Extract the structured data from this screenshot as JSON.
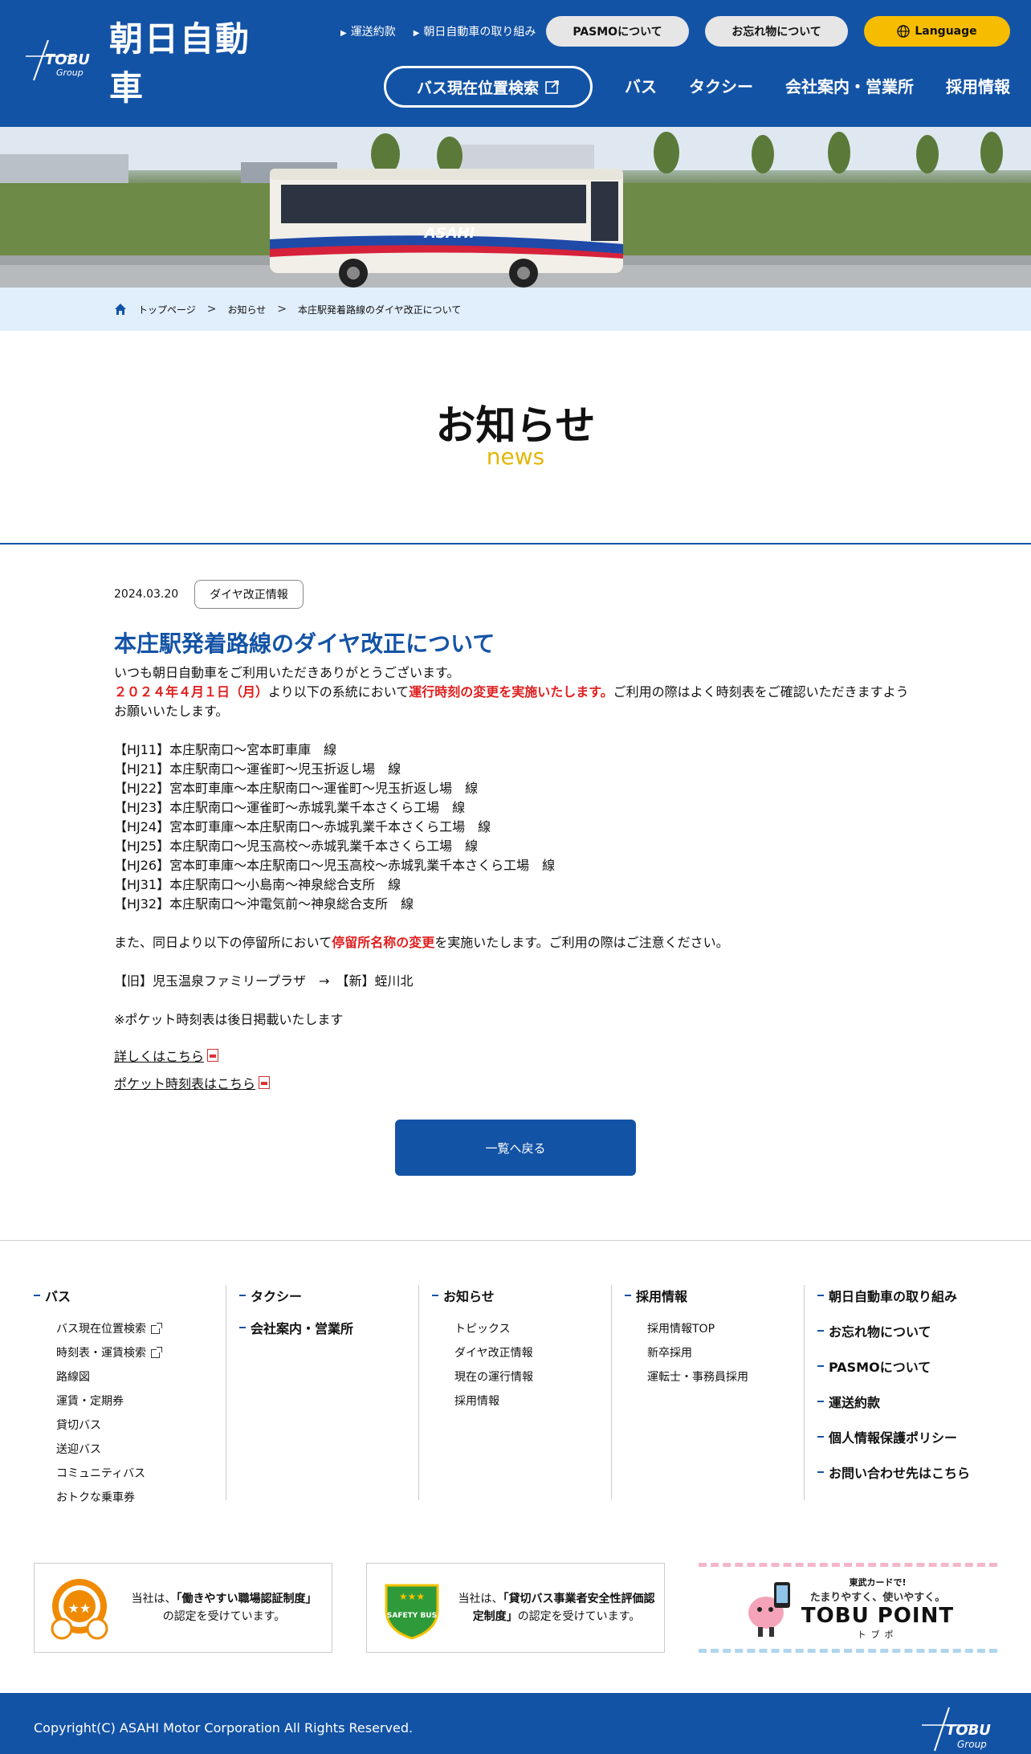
{
  "header": {
    "logo_text": "朝日自動車",
    "logo_mark_text": "TOBU",
    "logo_mark_sub": "Group",
    "toplinks": [
      "運送約款",
      "朝日自動車の取り組み"
    ],
    "pasmo_label": "PASMOについて",
    "lost_label": "お忘れ物について",
    "language_label": "Language",
    "bus_search_label": "バス現在位置検索",
    "nav": [
      "バス",
      "タクシー",
      "会社案内・営業所",
      "採用情報"
    ]
  },
  "hero": {
    "bus_label": "ASAHI"
  },
  "breadcrumb": {
    "home": "トップページ",
    "level2": "お知らせ",
    "current": "本庄駅発着路線のダイヤ改正について",
    "separator": ">"
  },
  "page": {
    "title": "お知らせ",
    "subtitle": "news"
  },
  "article": {
    "date": "2024.03.20",
    "tag": "ダイヤ改正情報",
    "title": "本庄駅発着路線のダイヤ改正について",
    "greeting": "いつも朝日自動車をご利用いただきありがとうございます。",
    "date_red": "２０２４年４月１日（月）",
    "sentence_mid": "より以下の系統において",
    "change_red": "運行時刻の変更を実施いたします。",
    "sentence_end": "ご利用の際はよく時刻表をご確認いただきますようお願いいたします。",
    "routes": [
      "【HJ11】本庄駅南口〜宮本町車庫　線",
      "【HJ21】本庄駅南口〜運雀町〜児玉折返し場　線",
      "【HJ22】宮本町車庫〜本庄駅南口〜運雀町〜児玉折返し場　線",
      "【HJ23】本庄駅南口〜運雀町〜赤城乳業千本さくら工場　線",
      "【HJ24】宮本町車庫〜本庄駅南口〜赤城乳業千本さくら工場　線",
      "【HJ25】本庄駅南口〜児玉高校〜赤城乳業千本さくら工場　線",
      "【HJ26】宮本町車庫〜本庄駅南口〜児玉高校〜赤城乳業千本さくら工場　線",
      "【HJ31】本庄駅南口〜小島南〜神泉総合支所　線",
      "【HJ32】本庄駅南口〜沖電気前〜神泉総合支所　線"
    ],
    "stop_pre": "また、同日より以下の停留所において",
    "stop_red": "停留所名称の変更",
    "stop_post": "を実施いたします。ご利用の際はご注意ください。",
    "rename": "【旧】児玉温泉ファミリープラザ　→　【新】蛭川北",
    "note": "※ポケット時刻表は後日掲載いたします",
    "link_detail": "詳しくはこちら",
    "link_pocket": "ポケット時刻表はこちら",
    "back_label": "一覧へ戻る"
  },
  "footer_nav": {
    "bus": {
      "title": "バス",
      "items": [
        "バス現在位置検索",
        "時刻表・運賃検索",
        "路線図",
        "運賃・定期券",
        "貸切バス",
        "送迎バス",
        "コミュニティバス",
        "おトクな乗車券"
      ]
    },
    "taxi": {
      "title": "タクシー",
      "title2": "会社案内・営業所"
    },
    "news": {
      "title": "お知らせ",
      "items": [
        "トピックス",
        "ダイヤ改正情報",
        "現在の運行情報",
        "採用情報"
      ]
    },
    "recruit": {
      "title": "採用情報",
      "items": [
        "採用情報TOP",
        "新卒採用",
        "運転士・事務員採用"
      ]
    },
    "links": [
      "朝日自動車の取り組み",
      "お忘れ物について",
      "PASMOについて",
      "運送約款",
      "個人情報保護ポリシー",
      "お問い合わせ先はこちら"
    ]
  },
  "badges": {
    "b1_pre": "当社は、",
    "b1_bold": "「働きやすい職場認証制度」",
    "b1_post": "の認定を受けています。",
    "b2_pre": "当社は、",
    "b2_bold": "「貸切バス事業者安全性評価認定制度」",
    "b2_post": "の認定を受けています。",
    "b2_icon_text": "SAFETY BUS",
    "tobu_small": "東武カードで!",
    "tobu_tagline": "たまりやすく、使いやすく。",
    "tobu_big": "TOBU POINT",
    "tobu_kana": "トブポ"
  },
  "footer": {
    "copyright": "Copyright(C) ASAHI Motor Corporation All Rights Reserved."
  },
  "colors": {
    "brand_blue": "#1353a6",
    "accent_yellow": "#f6bd00",
    "red": "#e01e1e"
  }
}
